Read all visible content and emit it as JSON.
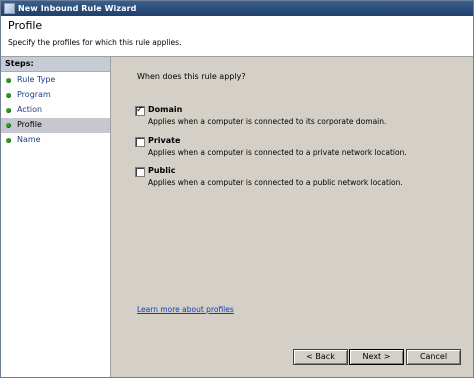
{
  "window": {
    "title": "New Inbound Rule Wizard"
  },
  "header": {
    "title": "Profile",
    "subtitle": "Specify the profiles for which this rule applies."
  },
  "steps": {
    "heading": "Steps:",
    "items": [
      {
        "label": "Rule Type"
      },
      {
        "label": "Program"
      },
      {
        "label": "Action"
      },
      {
        "label": "Profile"
      },
      {
        "label": "Name"
      }
    ],
    "active_index": 3
  },
  "content": {
    "question": "When does this rule apply?",
    "options": [
      {
        "label": "Domain",
        "description": "Applies when a computer is connected to its corporate domain.",
        "checked": true
      },
      {
        "label": "Private",
        "description": "Applies when a computer is connected to a private network location.",
        "checked": false
      },
      {
        "label": "Public",
        "description": "Applies when a computer is connected to a public network location.",
        "checked": false
      }
    ],
    "learn_more": "Learn more about profiles"
  },
  "buttons": {
    "back": "< Back",
    "next": "Next >",
    "cancel": "Cancel"
  }
}
